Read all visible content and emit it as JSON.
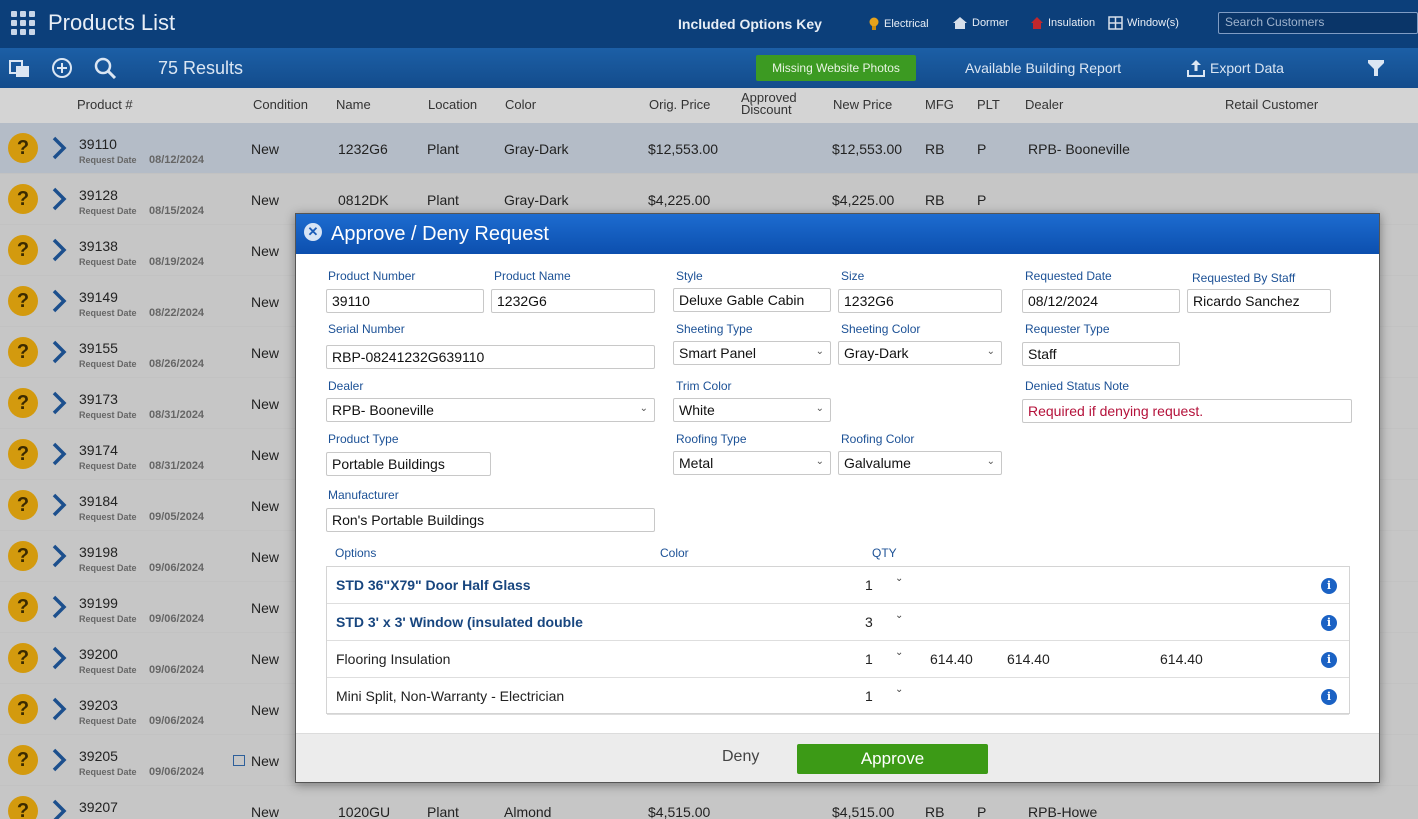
{
  "header": {
    "title": "Products List",
    "options_key_label": "Included Options Key",
    "keys": [
      {
        "label": "Electrical",
        "icon": "lightbulb-icon"
      },
      {
        "label": "Dormer",
        "icon": "house-icon"
      },
      {
        "label": "Insulation",
        "icon": "insulation-icon"
      },
      {
        "label": "Window(s)",
        "icon": "window-icon"
      }
    ],
    "search_placeholder": "Search Customers"
  },
  "toolbar": {
    "results": "75 Results",
    "missing_photos": "Missing Website Photos",
    "available_report": "Available Building Report",
    "export": "Export Data"
  },
  "columns": [
    "Product #",
    "Condition",
    "Name",
    "Location",
    "Color",
    "Orig. Price",
    "Approved Discount",
    "New Price",
    "MFG",
    "PLT",
    "Dealer",
    "Retail Customer"
  ],
  "request_date_label": "Request Date",
  "rows": [
    {
      "num": "39110",
      "date": "08/12/2024",
      "condition": "New",
      "name": "1232G6",
      "location": "Plant",
      "color": "Gray-Dark",
      "orig": "$12,553.00",
      "newp": "$12,553.00",
      "mfg": "RB",
      "plt": "P",
      "dealer": "RPB- Booneville"
    },
    {
      "num": "39128",
      "date": "08/15/2024",
      "condition": "New",
      "name": "0812DK",
      "location": "Plant",
      "color": "Gray-Dark",
      "orig": "$4,225.00",
      "newp": "$4,225.00",
      "mfg": "RB",
      "plt": "P",
      "dealer": ""
    },
    {
      "num": "39138",
      "date": "08/19/2024",
      "condition": "New"
    },
    {
      "num": "39149",
      "date": "08/22/2024",
      "condition": "New"
    },
    {
      "num": "39155",
      "date": "08/26/2024",
      "condition": "New"
    },
    {
      "num": "39173",
      "date": "08/31/2024",
      "condition": "New"
    },
    {
      "num": "39174",
      "date": "08/31/2024",
      "condition": "New"
    },
    {
      "num": "39184",
      "date": "09/05/2024",
      "condition": "New"
    },
    {
      "num": "39198",
      "date": "09/06/2024",
      "condition": "New"
    },
    {
      "num": "39199",
      "date": "09/06/2024",
      "condition": "New"
    },
    {
      "num": "39200",
      "date": "09/06/2024",
      "condition": "New"
    },
    {
      "num": "39203",
      "date": "09/06/2024",
      "condition": "New"
    },
    {
      "num": "39205",
      "date": "09/06/2024",
      "condition": "New"
    },
    {
      "num": "39207",
      "date": "",
      "condition": "New",
      "name": "1020GU",
      "location": "Plant",
      "color": "Almond",
      "orig": "$4,515.00",
      "newp": "$4,515.00",
      "mfg": "RB",
      "plt": "P",
      "dealer": "RPB-Howe"
    }
  ],
  "modal": {
    "title": "Approve / Deny Request",
    "fields": {
      "product_number": {
        "label": "Product Number",
        "value": "39110"
      },
      "product_name": {
        "label": "Product Name",
        "value": "1232G6"
      },
      "style": {
        "label": "Style",
        "value": "Deluxe Gable Cabin"
      },
      "size": {
        "label": "Size",
        "value": "1232G6"
      },
      "requested_date": {
        "label": "Requested Date",
        "value": "08/12/2024"
      },
      "requested_by": {
        "label": "Requested By Staff",
        "value": "Ricardo Sanchez"
      },
      "serial_number": {
        "label": "Serial Number",
        "value": "RBP-08241232G639110"
      },
      "sheeting_type": {
        "label": "Sheeting Type",
        "value": "Smart Panel"
      },
      "sheeting_color": {
        "label": "Sheeting Color",
        "value": "Gray-Dark"
      },
      "requester_type": {
        "label": "Requester Type",
        "value": "Staff"
      },
      "dealer": {
        "label": "Dealer",
        "value": "RPB- Booneville"
      },
      "trim_color": {
        "label": "Trim Color",
        "value": "White"
      },
      "denied_note": {
        "label": "Denied Status Note",
        "placeholder": "Required if denying request."
      },
      "product_type": {
        "label": "Product Type",
        "value": "Portable Buildings"
      },
      "roofing_type": {
        "label": "Roofing Type",
        "value": "Metal"
      },
      "roofing_color": {
        "label": "Roofing Color",
        "value": "Galvalume"
      },
      "manufacturer": {
        "label": "Manufacturer",
        "value": "Ron's Portable Buildings"
      }
    },
    "options_headers": {
      "options": "Options",
      "color": "Color",
      "qty": "QTY"
    },
    "options": [
      {
        "name": "STD 36\"X79\"  Door Half Glass",
        "qty": "1",
        "bold": true,
        "v1": "",
        "v2": "",
        "v3": ""
      },
      {
        "name": "STD 3' x 3' Window (insulated double",
        "qty": "3",
        "bold": true,
        "v1": "",
        "v2": "",
        "v3": ""
      },
      {
        "name": "Flooring Insulation",
        "qty": "1",
        "bold": false,
        "v1": "614.40",
        "v2": "614.40",
        "v3": "614.40"
      },
      {
        "name": "Mini Split, Non-Warranty - Electrician",
        "qty": "1",
        "bold": false,
        "v1": "",
        "v2": "",
        "v3": ""
      }
    ],
    "deny": "Deny",
    "approve": "Approve"
  }
}
